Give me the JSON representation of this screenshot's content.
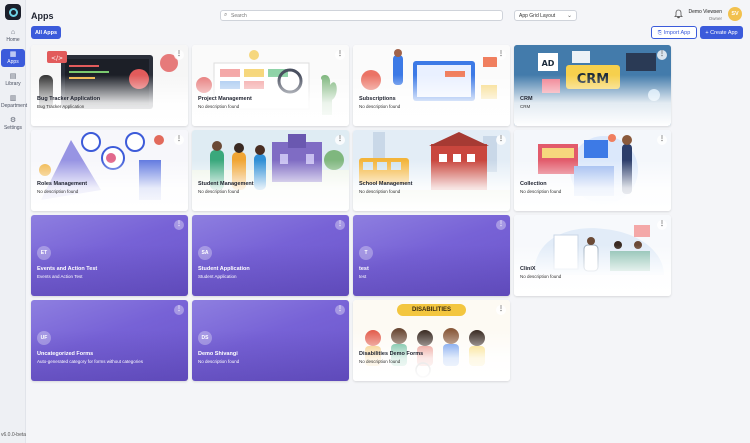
{
  "sidebar": {
    "items": [
      {
        "label": "Home",
        "icon": "home-icon"
      },
      {
        "label": "Apps",
        "icon": "apps-grid-icon"
      },
      {
        "label": "Library",
        "icon": "library-icon"
      },
      {
        "label": "Department",
        "icon": "department-icon"
      },
      {
        "label": "Settings",
        "icon": "gear-icon"
      }
    ],
    "version": "v6.0.0-beta"
  },
  "header": {
    "title": "Apps",
    "search_placeholder": "Search",
    "layout_select": "App Grid Layout",
    "user_name": "Demo Viewsen",
    "user_role": "Owner",
    "avatar_initials": "SV"
  },
  "toolbar": {
    "all_apps": "All Apps",
    "import_app": "Import App",
    "create_app": "+ Create App"
  },
  "apps": [
    {
      "title": "Bug Tracker Application",
      "desc": "Bug Tracker Application",
      "style": "image"
    },
    {
      "title": "Project Management",
      "desc": "No description found",
      "style": "image"
    },
    {
      "title": "Subscriptions",
      "desc": "No description found",
      "style": "image"
    },
    {
      "title": "CRM",
      "desc": "CRM",
      "style": "image"
    },
    {
      "title": "Roles Management",
      "desc": "No description found",
      "style": "image"
    },
    {
      "title": "Student Management",
      "desc": "No description found",
      "style": "image"
    },
    {
      "title": "School Management",
      "desc": "No description found",
      "style": "image"
    },
    {
      "title": "Collection",
      "desc": "No description found",
      "style": "image"
    },
    {
      "title": "Events and Action Test",
      "desc": "Events and Action Test",
      "style": "purple",
      "initials": "ET"
    },
    {
      "title": "Student Application",
      "desc": "Student Application",
      "style": "purple",
      "initials": "SA"
    },
    {
      "title": "test",
      "desc": "test",
      "style": "purple",
      "initials": "T"
    },
    {
      "title": "CliniX",
      "desc": "No description found",
      "style": "image"
    },
    {
      "title": "Uncategorized Forms",
      "desc": "Auto-generated category for forms without categories",
      "style": "purple",
      "initials": "UF"
    },
    {
      "title": "Demo Shivangi",
      "desc": "No description found",
      "style": "purple",
      "initials": "DS"
    },
    {
      "title": "Disabilities Demo Forms",
      "desc": "No description found",
      "style": "image",
      "banner": "DISABILITIES"
    }
  ],
  "card_menu_glyph": "⋮",
  "colors": {
    "accent": "#3b5bdb",
    "avatar": "#f2c14e",
    "purple_card": "#7762d6"
  }
}
